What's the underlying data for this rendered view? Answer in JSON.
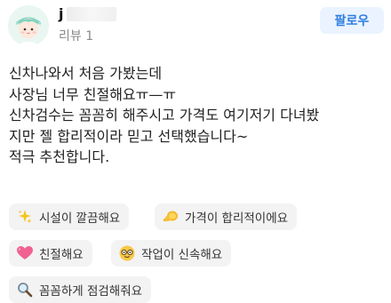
{
  "header": {
    "username": "j",
    "review_count": "리뷰 1",
    "follow_label": "팔로우"
  },
  "review": {
    "text": "신차나와서 처음 가봤는데\n사장님 너무 친절해요ㅠ—ㅠ\n신차검수는 꼼꼼히 해주시고 가격도 여기저기 다녀봤\n지만 젤 합리적이라 믿고 선택했습니다~\n적극 추천합니다."
  },
  "keywords": [
    {
      "label": "시설이 깔끔해요",
      "icon": "sparkles-icon"
    },
    {
      "label": "가격이 합리적이에요",
      "icon": "money-icon"
    },
    {
      "label": "친절해요",
      "icon": "heart-icon"
    },
    {
      "label": "작업이 신속해요",
      "icon": "nerd-face-icon"
    },
    {
      "label": "꼼꼼하게 점검해줘요",
      "icon": "magnifier-icon"
    }
  ],
  "colors": {
    "follow_text": "#2f7de1",
    "follow_bg": "#eaf3ff",
    "chip_bg": "#f3f3f3"
  }
}
